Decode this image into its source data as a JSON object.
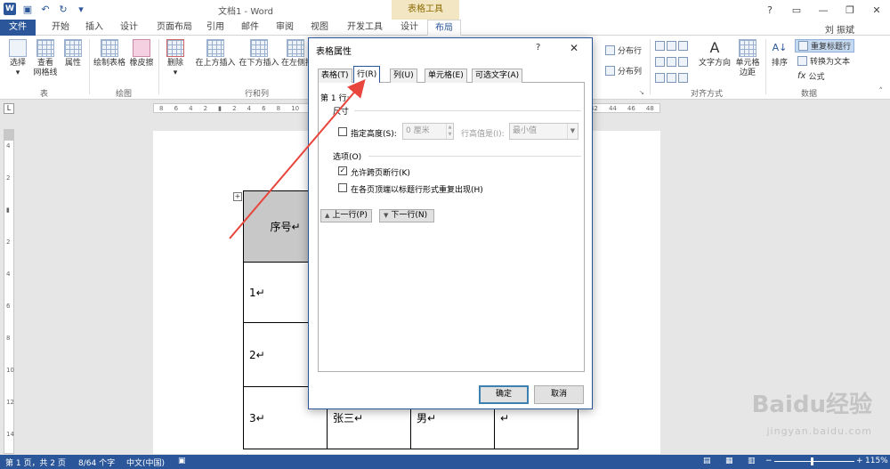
{
  "titlebar": {
    "title": "文档1 - Word",
    "context_tab": "表格工具",
    "help": "?",
    "window_minimize": "—",
    "window_restore": "❐",
    "window_close": "✕"
  },
  "tabs": [
    "文件",
    "开始",
    "插入",
    "设计",
    "页面布局",
    "引用",
    "邮件",
    "审阅",
    "视图",
    "开发工具",
    "设计",
    "布局"
  ],
  "user": "刘 振斌",
  "ribbon": {
    "groups": {
      "table": "表",
      "draw": "绘图",
      "rows_cols": "行和列",
      "merge": "合并",
      "cell_size": "单元格大小",
      "align": "对齐方式",
      "data": "数据"
    },
    "buttons": {
      "select": "选择",
      "view_gridlines": "查看\n网格线",
      "properties": "属性",
      "draw_table": "绘制表格",
      "eraser": "橡皮擦",
      "delete": "删除",
      "insert_above": "在上方插入",
      "insert_below": "在下方插入",
      "insert_left": "在左侧插入",
      "distribute_rows": "分布行",
      "distribute_cols": "分布列",
      "text_direction": "文字方向",
      "cell_margins": "单元格\n边距",
      "sort": "排序",
      "repeat_header": "重复标题行",
      "convert_text": "转换为文本",
      "formula": "公式"
    }
  },
  "ruler": {
    "marks": [
      "8",
      "6",
      "4",
      "2",
      "",
      "2",
      "4",
      "6",
      "8",
      "10",
      "12",
      "14",
      "16",
      "18",
      "20",
      "22",
      "24",
      "26",
      "28",
      "30",
      "32",
      "34",
      "36",
      "38",
      "40",
      "42",
      "44",
      "46",
      "48"
    ],
    "vmarks": [
      "4",
      "2",
      "",
      "2",
      "4",
      "6",
      "8",
      "10",
      "12",
      "14"
    ]
  },
  "document": {
    "table": {
      "header": [
        "序号↵",
        "",
        "",
        ""
      ],
      "rows": [
        [
          "1↵",
          "",
          "",
          ""
        ],
        [
          "2↵",
          "",
          "",
          ""
        ],
        [
          "3↵",
          "张三↵",
          "男↵",
          "↵"
        ]
      ]
    }
  },
  "dialog": {
    "title": "表格属性",
    "help": "?",
    "close": "✕",
    "tabs": [
      "表格(T)",
      "行(R)",
      "列(U)",
      "单元格(E)",
      "可选文字(A)"
    ],
    "active_tab_index": 1,
    "row_heading": "第 1 行:",
    "size_section": "尺寸",
    "specify_height_label": "指定高度(S):",
    "specify_height_checked": false,
    "height_value": "0 厘米",
    "row_height_is_label": "行高值是(I):",
    "row_height_is_value": "最小值",
    "options_section": "选项(O)",
    "allow_break": "允许跨页断行(K)",
    "allow_break_checked": true,
    "repeat_header": "在各页顶端以标题行形式重复出现(H)",
    "repeat_header_checked": false,
    "prev_row": "上一行(P)",
    "next_row": "下一行(N)",
    "ok": "确定",
    "cancel": "取消"
  },
  "statusbar": {
    "page": "第 1 页，共 2 页",
    "words": "8/64 个字",
    "language": "中文(中国)",
    "zoom": "115%",
    "zoom_minus": "−",
    "zoom_plus": "+"
  },
  "watermark": {
    "brand": "Baidu经验",
    "url": "jingyan.baidu.com"
  },
  "colors": {
    "accent": "#2b579a",
    "arrow": "#e8453c",
    "context_tab": "#f3e7c3"
  }
}
